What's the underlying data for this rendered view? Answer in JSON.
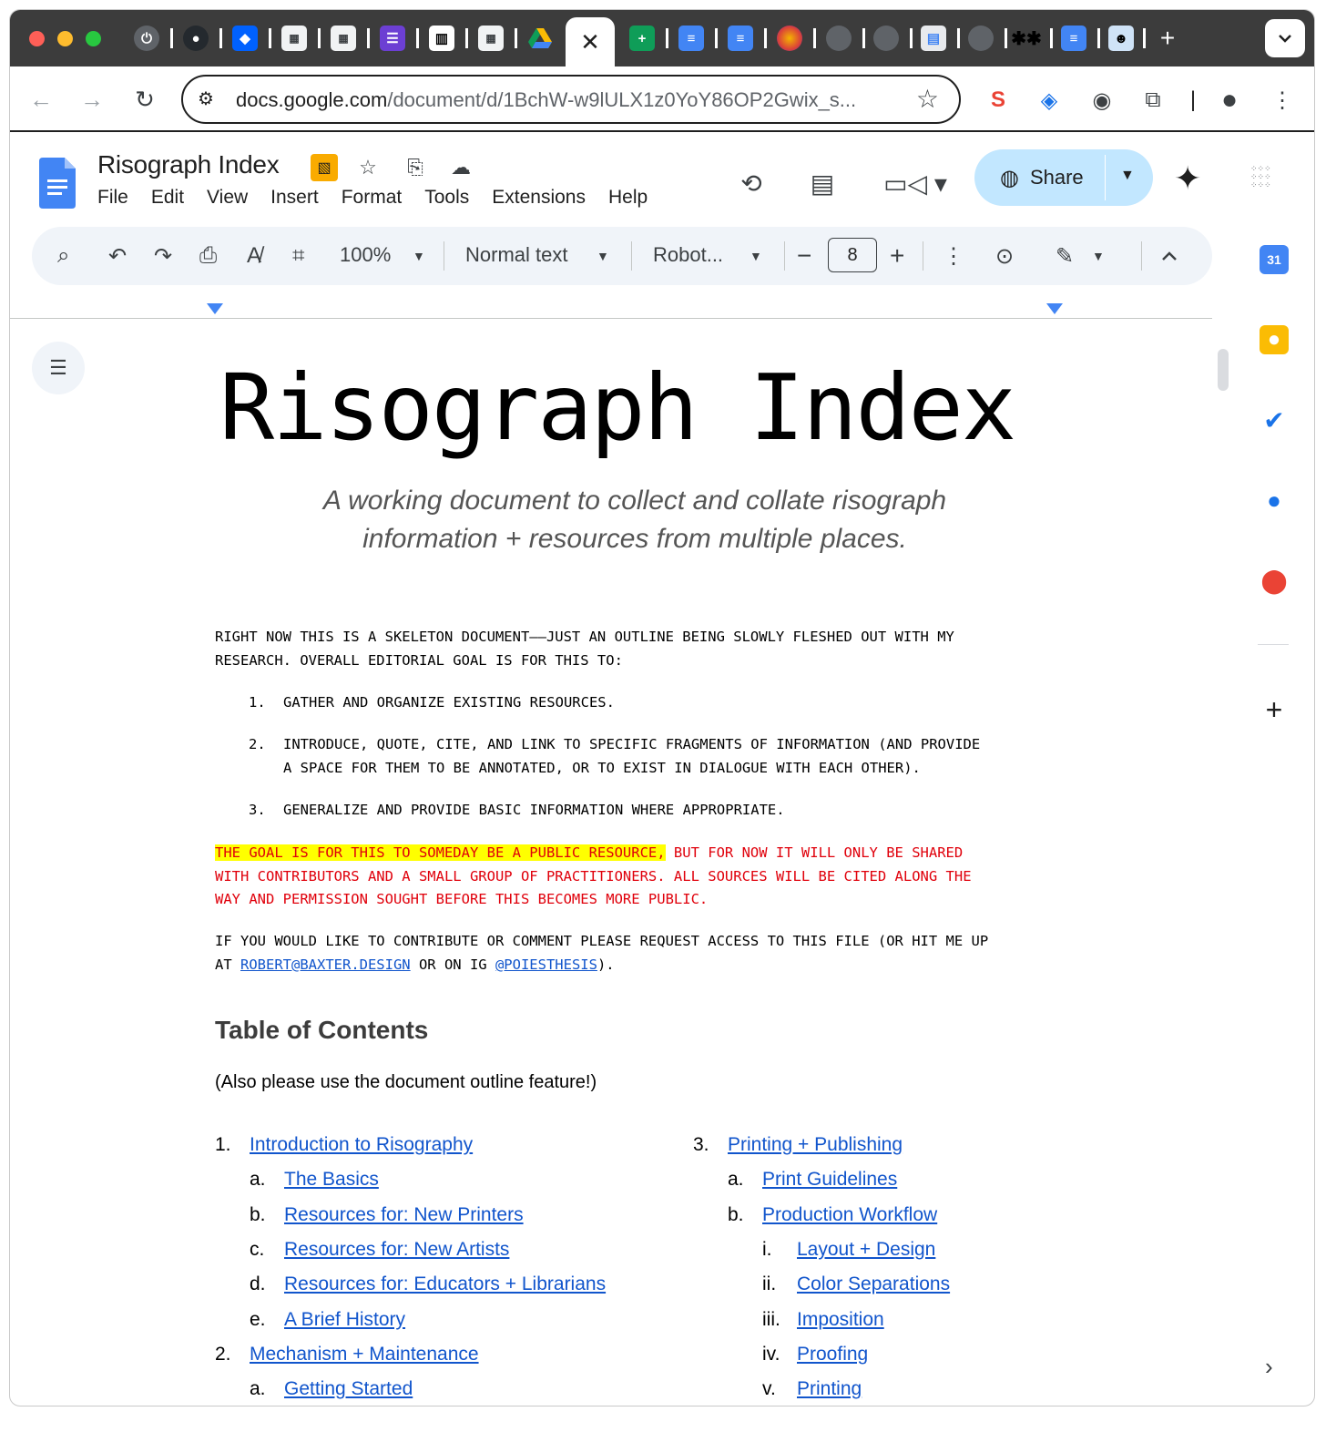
{
  "browser": {
    "active_tab_close": "✕",
    "new_tab": "+",
    "tab_menu": "⌄",
    "url_host": "docs.google.com",
    "url_path": "/document/d/1BchW-w9lULX1z0YoY86OP2Gwix_s...",
    "icons": [
      "power-icon",
      "github-icon",
      "dropbox-icon",
      "app-icon",
      "app-icon",
      "list-icon",
      "museum-icon",
      "app-icon",
      "drive-icon",
      "sheets-icon",
      "docs-icon",
      "docs-icon",
      "record-icon",
      "globe-icon",
      "globe-icon",
      "spreadsheet-icon",
      "globe-icon",
      "asterisk-icon",
      "docs-icon",
      "avatar-icon"
    ]
  },
  "docs": {
    "title": "Risograph Index",
    "menu": [
      "File",
      "Edit",
      "View",
      "Insert",
      "Format",
      "Tools",
      "Extensions",
      "Help"
    ],
    "share_label": "Share",
    "toolbar": {
      "zoom": "100%",
      "style": "Normal text",
      "font": "Robot...",
      "font_size": "8"
    }
  },
  "document": {
    "heading": "Risograph Index",
    "subtitle": "A working document to collect and collate risograph information + resources from multiple places.",
    "intro_line1": "RIGHT NOW THIS IS A SKELETON DOCUMENT——JUST AN OUTLINE BEING SLOWLY FLESHED OUT WITH MY",
    "intro_line2": "RESEARCH. OVERALL EDITORIAL GOAL IS FOR THIS TO:",
    "goals": [
      {
        "num": "1.",
        "line1": "GATHER AND ORGANIZE EXISTING RESOURCES.",
        "line2": ""
      },
      {
        "num": "2.",
        "line1": "INTRODUCE, QUOTE, CITE, AND LINK TO SPECIFIC FRAGMENTS OF INFORMATION (AND PROVIDE",
        "line2": "A SPACE FOR THEM TO BE ANNOTATED, OR TO EXIST IN DIALOGUE WITH EACH OTHER)."
      },
      {
        "num": "3.",
        "line1": "GENERALIZE AND PROVIDE BASIC INFORMATION WHERE APPROPRIATE.",
        "line2": ""
      }
    ],
    "notice_highlight": "THE GOAL IS FOR THIS TO SOMEDAY BE A PUBLIC RESOURCE,",
    "notice_rest": " BUT FOR NOW IT WILL ONLY BE SHARED",
    "notice_line2": "WITH CONTRIBUTORS AND A SMALL GROUP OF PRACTITIONERS. ALL SOURCES WILL BE CITED ALONG THE",
    "notice_line3": "WAY AND PERMISSION SOUGHT BEFORE THIS BECOMES MORE PUBLIC.",
    "contact_line1": "IF YOU WOULD LIKE TO CONTRIBUTE OR COMMENT PLEASE REQUEST ACCESS TO THIS FILE (OR HIT ME UP",
    "contact_at": "AT ",
    "contact_email": "ROBERT@BAXTER.DESIGN",
    "contact_mid": " OR ON IG ",
    "contact_ig": "@POIESTHESIS",
    "contact_end": ").",
    "toc_title": "Table of Contents",
    "toc_note": "(Also please use the document outline feature!)",
    "toc_left": [
      {
        "n": "1.",
        "label": "Introduction to Risography",
        "level": 0
      },
      {
        "n": "a.",
        "label": "The Basics",
        "level": 1
      },
      {
        "n": "b.",
        "label": "Resources for: New Printers",
        "level": 1
      },
      {
        "n": "c.",
        "label": "Resources for: New Artists",
        "level": 1
      },
      {
        "n": "d.",
        "label": "Resources for: Educators + Librarians",
        "level": 1
      },
      {
        "n": "e.",
        "label": "A Brief History",
        "level": 1
      },
      {
        "n": "2.",
        "label": "Mechanism + Maintenance",
        "level": 0
      },
      {
        "n": "a.",
        "label": "Getting Started",
        "level": 1
      }
    ],
    "toc_right": [
      {
        "n": "3.",
        "label": "Printing + Publishing",
        "level": 0
      },
      {
        "n": "a.",
        "label": "Print Guidelines",
        "level": 1
      },
      {
        "n": "b.",
        "label": "Production Workflow",
        "level": 1
      },
      {
        "n": "i.",
        "label": "Layout + Design",
        "level": 2
      },
      {
        "n": "ii.",
        "label": "Color Separations",
        "level": 2
      },
      {
        "n": "iii.",
        "label": "Imposition",
        "level": 2
      },
      {
        "n": "iv.",
        "label": "Proofing",
        "level": 2
      },
      {
        "n": "v.",
        "label": "Printing",
        "level": 2
      }
    ]
  },
  "colors": {
    "share_bg": "#c2e7ff",
    "link": "#1155cc",
    "notice_red": "#e0000b",
    "highlight": "#ffff00",
    "docs_blue": "#4285f4"
  }
}
